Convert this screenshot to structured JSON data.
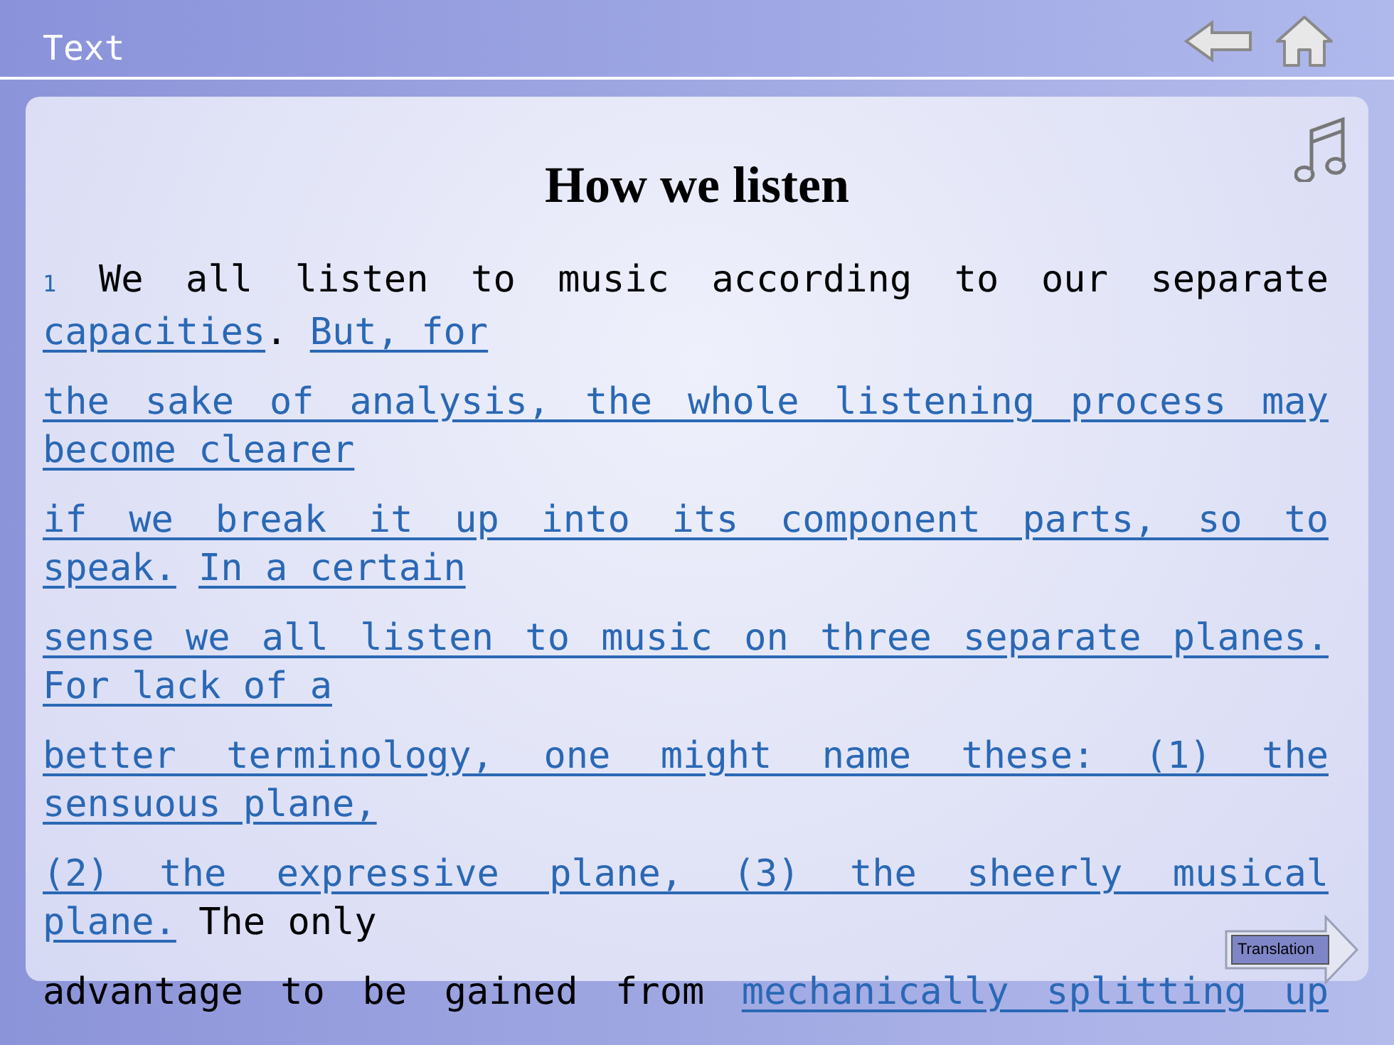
{
  "header": {
    "title": "Text"
  },
  "article": {
    "title": "How we listen",
    "paragraphs": [
      {
        "number": "1",
        "lines": [
          {
            "segments": [
              {
                "kind": "plain",
                "text": " We all listen to music according to our separate"
              }
            ]
          },
          {
            "segments": [
              {
                "kind": "link",
                "text": "capacities"
              },
              {
                "kind": "plain",
                "text": ". "
              },
              {
                "kind": "link",
                "text": "But, for"
              }
            ]
          }
        ]
      },
      {
        "lines": [
          {
            "segments": [
              {
                "kind": "link",
                "text": "the sake of analysis, the whole listening process may"
              }
            ]
          },
          {
            "segments": [
              {
                "kind": "link",
                "text": "become clearer"
              }
            ]
          }
        ]
      },
      {
        "lines": [
          {
            "segments": [
              {
                "kind": "link",
                "text": "if we break it up into its component parts, so to"
              }
            ]
          },
          {
            "segments": [
              {
                "kind": "link",
                "text": "speak."
              },
              {
                "kind": "link",
                "text": "In a certain"
              }
            ]
          }
        ]
      },
      {
        "lines": [
          {
            "segments": [
              {
                "kind": "link",
                "text": "sense we all listen to music on three separate planes."
              }
            ]
          },
          {
            "segments": [
              {
                "kind": "link",
                "text": "For lack of a"
              }
            ]
          }
        ]
      },
      {
        "lines": [
          {
            "segments": [
              {
                "kind": "link",
                "text": "better terminology, one might name these: (1) the"
              }
            ]
          },
          {
            "segments": [
              {
                "kind": "link",
                "text": "sensuous plane,"
              }
            ]
          }
        ]
      },
      {
        "lines": [
          {
            "segments": [
              {
                "kind": "link",
                "text": "(2) the expressive plane, (3) the sheerly musical"
              }
            ]
          },
          {
            "segments": [
              {
                "kind": "link",
                "text": "plane."
              },
              {
                "kind": "plain",
                "text": " The only"
              }
            ]
          }
        ]
      },
      {
        "lines": [
          {
            "segments": [
              {
                "kind": "plain",
                "text": "advantage to be gained from "
              },
              {
                "kind": "link",
                "text": "mechanically splitting up"
              }
            ]
          }
        ]
      }
    ]
  },
  "translation_button": {
    "label": "Translation"
  }
}
